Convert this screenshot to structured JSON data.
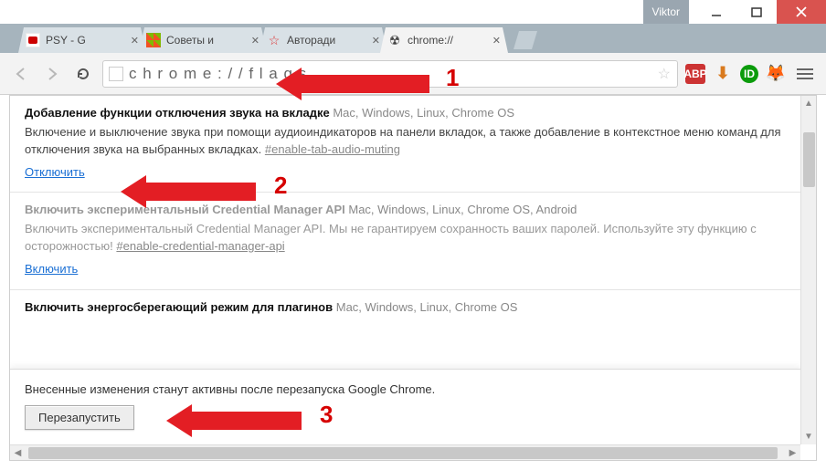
{
  "window": {
    "user_label": "Viktor"
  },
  "tabs": [
    {
      "title": "PSY - G",
      "favicon": "youtube"
    },
    {
      "title": "Советы и",
      "favicon": "windows"
    },
    {
      "title": "Авторади",
      "favicon": "star"
    },
    {
      "title": "chrome://",
      "favicon": "radiation",
      "active": true
    }
  ],
  "address": {
    "url": "c h r o m e : / / f l a g s"
  },
  "extensions": {
    "abp_label": "ABP",
    "id_label": "ID"
  },
  "flags": [
    {
      "state": "enabled",
      "title": "Добавление функции отключения звука на вкладке",
      "platforms": "Mac, Windows, Linux, Chrome OS",
      "desc": "Включение и выключение звука при помощи аудиоиндикаторов на панели вкладок, а также добавление в контекстное меню команд для отключения звука на выбранных вкладках.",
      "anchor": "#enable-tab-audio-muting",
      "action": "Отключить"
    },
    {
      "state": "disabled",
      "title": "Включить экспериментальный Credential Manager API",
      "platforms": "Mac, Windows, Linux, Chrome OS, Android",
      "desc": "Включить экспериментальный Credential Manager API. Мы не гарантируем сохранность ваших паролей. Используйте эту функцию с осторожностью!",
      "anchor": "#enable-credential-manager-api",
      "action": "Включить"
    },
    {
      "state": "enabled_truncated",
      "title": "Включить энергосберегающий режим для плагинов",
      "platforms": "Mac, Windows, Linux, Chrome OS"
    }
  ],
  "restart": {
    "message": "Внесенные изменения станут активны после перезапуска Google Chrome.",
    "button": "Перезапустить"
  },
  "annotations": {
    "n1": "1",
    "n2": "2",
    "n3": "3"
  }
}
